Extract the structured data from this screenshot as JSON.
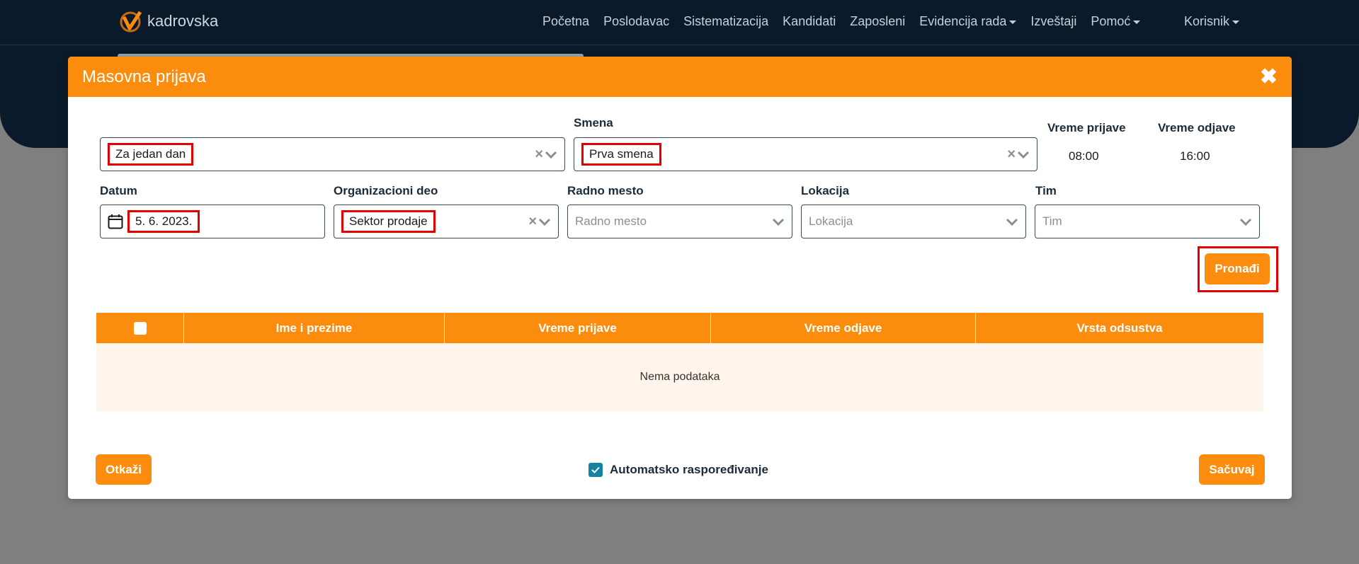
{
  "app": {
    "brand": "kadrovska",
    "nav": [
      "Početna",
      "Poslodavac",
      "Sistematizacija",
      "Kandidati",
      "Zaposleni",
      "Evidencija rada",
      "Izveštaji",
      "Pomoć"
    ],
    "user_menu": "Korisnik"
  },
  "modal": {
    "title": "Masovna prijava",
    "close_symbol": "✖",
    "period": {
      "value": "Za jedan dan"
    },
    "shift": {
      "label": "Smena",
      "value": "Prva smena"
    },
    "check_in": {
      "label": "Vreme prijave",
      "value": "08:00"
    },
    "check_out": {
      "label": "Vreme odjave",
      "value": "16:00"
    },
    "date": {
      "label": "Datum",
      "value": "5. 6. 2023."
    },
    "org_unit": {
      "label": "Organizacioni deo",
      "value": "Sektor prodaje"
    },
    "position": {
      "label": "Radno mesto",
      "placeholder": "Radno mesto"
    },
    "location": {
      "label": "Lokacija",
      "placeholder": "Lokacija"
    },
    "team": {
      "label": "Tim",
      "placeholder": "Tim"
    },
    "find_label": "Pronađi",
    "table": {
      "columns": [
        "Ime i prezime",
        "Vreme prijave",
        "Vreme odjave",
        "Vrsta odsustva"
      ],
      "empty_text": "Nema podataka"
    },
    "cancel_label": "Otkaži",
    "auto_assign_label": "Automatsko raspoređivanje",
    "auto_assign_checked": true,
    "save_label": "Sačuvaj"
  },
  "colors": {
    "accent": "#fb8c0e",
    "navbar": "#0b1a2b",
    "highlight": "#e30000",
    "checkbox": "#1781a3"
  }
}
